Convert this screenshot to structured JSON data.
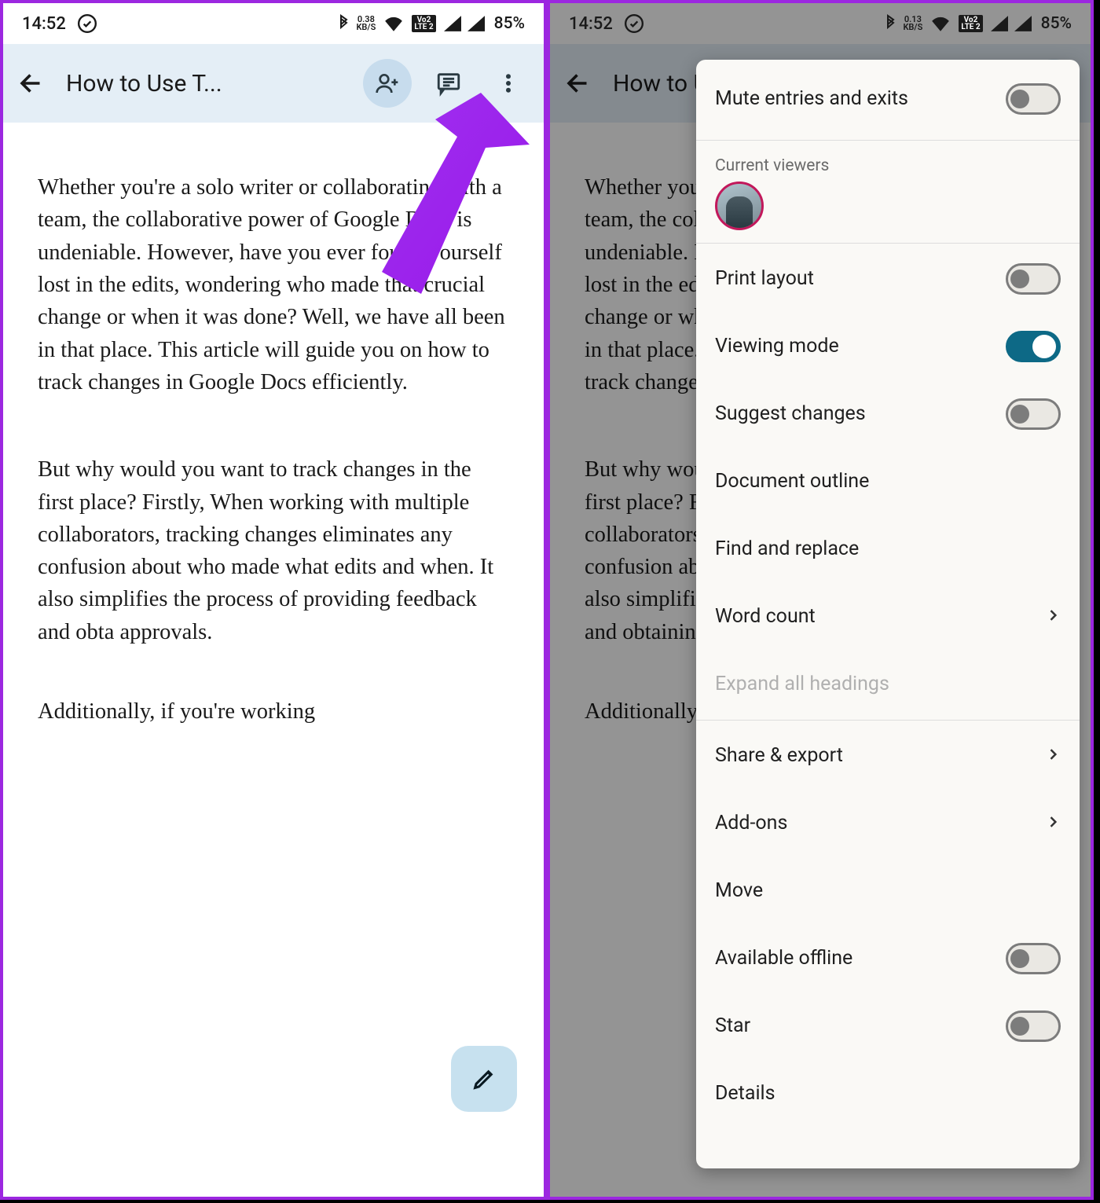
{
  "status": {
    "time": "14:52",
    "net_speed_top": "0.38",
    "net_speed_top_r": "0.13",
    "net_speed_unit": "KB/S",
    "lte_top": "Vo2",
    "lte_bottom": "LTE 2",
    "battery": "85%"
  },
  "appbar": {
    "title": "How to Use T..."
  },
  "doc": {
    "p1": "Whether you're a solo writer or collaborating with a team, the collaborative power of Google Docs is undeniable. However, have you ever found yourself lost in the edits, wondering who made that crucial change or when it was done? Well, we have all been in that place. This article will guide you on how to track changes in Google Docs efficiently.",
    "p2": "But why would you want to track changes in the first place? Firstly, When working with multiple collaborators, tracking changes eliminates any confusion about who made what edits and when. It also simplifies the process of providing feedback and obta approvals.",
    "p2b": "But why would you want to track changes in the first place? Firstly, When working with multiple collaborators, tracking changes eliminates any confusion about who made what edits and when. It also simplifies the process of providing feedback and obtaining approvals.",
    "p3": "Additionally, if you're working"
  },
  "menu": {
    "mute": "Mute entries and exits",
    "current_viewers": "Current viewers",
    "print_layout": "Print layout",
    "viewing_mode": "Viewing mode",
    "suggest_changes": "Suggest changes",
    "document_outline": "Document outline",
    "find_replace": "Find and replace",
    "word_count": "Word count",
    "expand_headings": "Expand all headings",
    "share_export": "Share & export",
    "addons": "Add-ons",
    "move": "Move",
    "available_offline": "Available offline",
    "star": "Star",
    "details": "Details"
  }
}
